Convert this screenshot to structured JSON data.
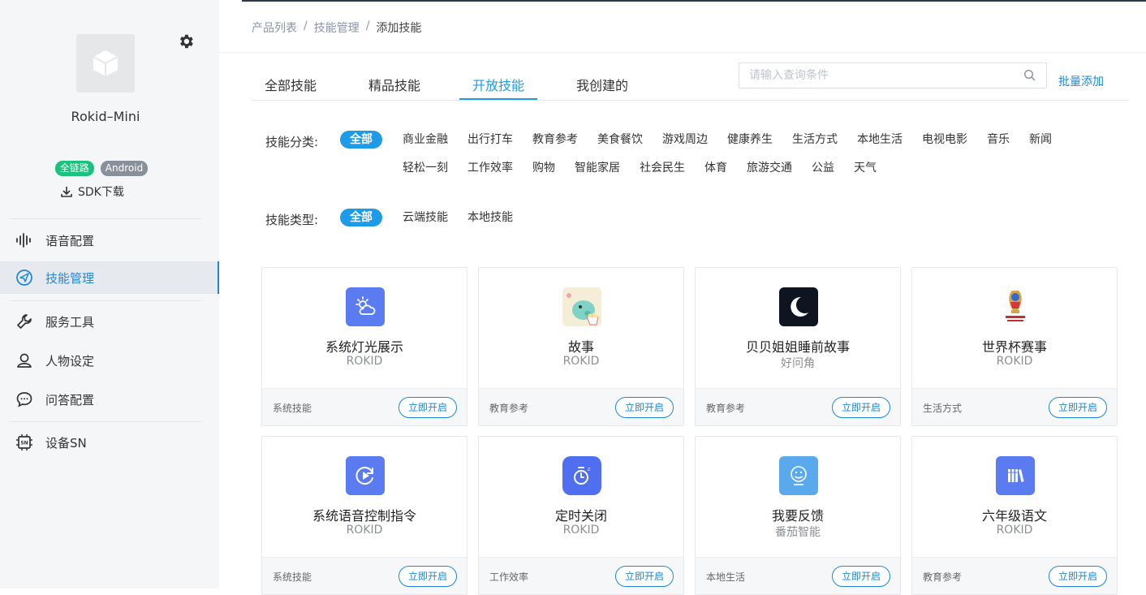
{
  "sidebar": {
    "device_name": "Rokid–Mini",
    "badges": [
      "全链路",
      "Android"
    ],
    "sdk_download": "SDK下载",
    "nav": [
      {
        "label": "语音配置"
      },
      {
        "label": "技能管理"
      },
      {
        "label": "服务工具"
      },
      {
        "label": "人物设定"
      },
      {
        "label": "问答配置"
      },
      {
        "label": "设备SN"
      }
    ],
    "active_index": 1
  },
  "breadcrumb": [
    "产品列表",
    "技能管理",
    "添加技能"
  ],
  "tabs": [
    "全部技能",
    "精品技能",
    "开放技能",
    "我创建的"
  ],
  "active_tab": "开放技能",
  "search": {
    "placeholder": "请输入查询条件"
  },
  "batch_add": "批量添加",
  "category_filter": {
    "label": "技能分类:",
    "row1": [
      "全部",
      "商业金融",
      "出行打车",
      "教育参考",
      "美食餐饮",
      "游戏周边",
      "健康养生",
      "生活方式",
      "本地生活",
      "电视电影",
      "音乐",
      "新闻"
    ],
    "row2": [
      "轻松一刻",
      "工作效率",
      "购物",
      "智能家居",
      "社会民生",
      "体育",
      "旅游交通",
      "公益",
      "天气"
    ],
    "selected": "全部"
  },
  "type_filter": {
    "label": "技能类型:",
    "options": [
      "全部",
      "云端技能",
      "本地技能"
    ],
    "selected": "全部"
  },
  "enable_label": "立即开启",
  "skills": [
    {
      "name": "系统灯光展示",
      "developer": "ROKID",
      "category": "系统技能",
      "icon": "weather-sun-cloud-icon"
    },
    {
      "name": "故事",
      "developer": "ROKID",
      "category": "教育参考",
      "icon": "dinosaur-popcorn-icon"
    },
    {
      "name": "贝贝姐姐睡前故事",
      "developer": "好问角",
      "category": "教育参考",
      "icon": "moon-stars-icon"
    },
    {
      "name": "世界杯赛事",
      "developer": "ROKID",
      "category": "生活方式",
      "icon": "world-cup-2018-icon"
    },
    {
      "name": "系统语音控制指令",
      "developer": "ROKID",
      "category": "系统技能",
      "icon": "play-refresh-icon"
    },
    {
      "name": "定时关闭",
      "developer": "ROKID",
      "category": "工作效率",
      "icon": "timer-icon"
    },
    {
      "name": "我要反馈",
      "developer": "番茄智能",
      "category": "本地生活",
      "icon": "feedback-face-icon"
    },
    {
      "name": "六年级语文",
      "developer": "ROKID",
      "category": "教育参考",
      "icon": "books-icon"
    }
  ],
  "colors": {
    "accent": "#1e9be8",
    "link": "#1e88d8",
    "badge_green": "#19c37d",
    "badge_gray": "#8a9099"
  }
}
